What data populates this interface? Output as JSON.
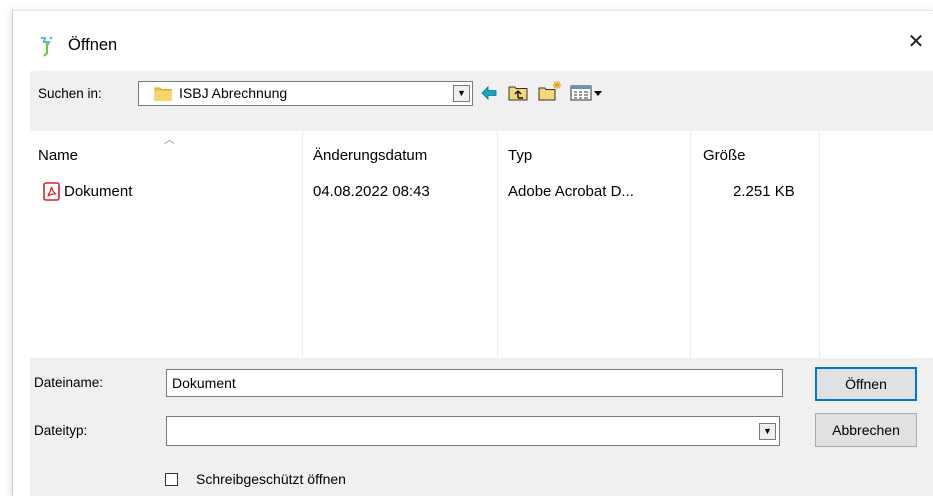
{
  "dialog": {
    "title": "Öffnen",
    "close_glyph": "✕"
  },
  "lookin": {
    "label": "Suchen in:",
    "folder": "ISBJ Abrechnung",
    "folder_icon": "folder-icon"
  },
  "toolbar": {
    "back_icon": "back-arrow-icon",
    "up_icon": "up-folder-icon",
    "new_folder_icon": "new-folder-icon",
    "view_icon": "view-menu-icon"
  },
  "filelist": {
    "columns": [
      "Name",
      "Änderungsdatum",
      "Typ",
      "Größe"
    ],
    "rows": [
      {
        "name": "Dokument",
        "date": "04.08.2022 08:43",
        "type": "Adobe Acrobat D...",
        "size": "2.251 KB",
        "icon": "pdf-file-icon"
      }
    ]
  },
  "filename": {
    "label": "Dateiname:",
    "value": "Dokument"
  },
  "filetype": {
    "label": "Dateityp:",
    "value": ""
  },
  "buttons": {
    "open": "Öffnen",
    "cancel": "Abbrechen"
  },
  "readonly": {
    "label": "Schreibgeschützt öffnen",
    "checked": false
  },
  "colors": {
    "client_bg": "#f0f0f0",
    "default_button_border": "#0078d7",
    "pdf_red": "#d9222a",
    "folder_yellow": "#f5c842",
    "back_arrow": "#19a4c6"
  }
}
